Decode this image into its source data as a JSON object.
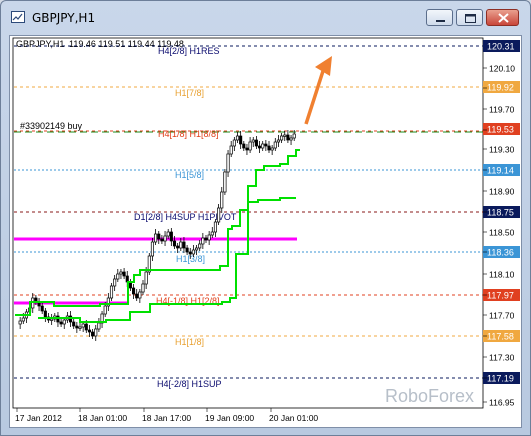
{
  "window": {
    "title": "GBPJPY,H1"
  },
  "chart_header": {
    "symbol_tf": "GBPJPY,H1",
    "ohlc": "119.46 119.51 119.44 119.48"
  },
  "watermark": "RoboForex",
  "order_label": "#33902149 buy",
  "level_labels": [
    {
      "text": "H4[2/8] H1RES",
      "color": "#0a0a6e"
    },
    {
      "text": "H1[7/8]",
      "color": "#e8a030"
    },
    {
      "text": "H4[1/8] H1[8/8]",
      "color": "#e0401a"
    },
    {
      "text": "H1[5/8]",
      "color": "#3b95d6"
    },
    {
      "text": "D1[2/8] H4SUP H1PIVOT",
      "color": "#0a0a6e"
    },
    {
      "text": "H1[3/8]",
      "color": "#3b95d6"
    },
    {
      "text": "H4[-1/8] H1[2/8]",
      "color": "#e0401a"
    },
    {
      "text": "H1[1/8]",
      "color": "#e8a030"
    },
    {
      "text": "H4[-2/8] H1SUP",
      "color": "#0a0a6e"
    }
  ],
  "price_boxes": [
    {
      "value": "120.31",
      "bg": "#0a1a5c",
      "fg": "#ffffff"
    },
    {
      "value": "119.92",
      "bg": "#f0a840",
      "fg": "#ffffff"
    },
    {
      "value": "119.53",
      "bg": "#e04020",
      "fg": "#ffffff"
    },
    {
      "value": "119.14",
      "bg": "#3b95d6",
      "fg": "#ffffff"
    },
    {
      "value": "118.75",
      "bg": "#0a1a5c",
      "fg": "#ffffff"
    },
    {
      "value": "118.36",
      "bg": "#3b95d6",
      "fg": "#ffffff"
    },
    {
      "value": "117.97",
      "bg": "#e04020",
      "fg": "#ffffff"
    },
    {
      "value": "117.58",
      "bg": "#f0a840",
      "fg": "#ffffff"
    },
    {
      "value": "117.19",
      "bg": "#0a1a5c",
      "fg": "#ffffff"
    }
  ],
  "y_ticks": [
    "120.10",
    "119.90",
    "119.70",
    "119.50",
    "119.30",
    "119.10",
    "118.90",
    "118.70",
    "118.50",
    "118.30",
    "118.10",
    "117.90",
    "117.70",
    "117.50",
    "117.30",
    "117.10",
    "116.95"
  ],
  "x_ticks": [
    "17 Jan 2012",
    "18 Jan 01:00",
    "18 Jan 17:00",
    "19 Jan 09:00",
    "20 Jan 01:00"
  ],
  "colors": {
    "pivot_line": "#ff00ff",
    "channel_lines": "#00e000",
    "arrow": "#f08030",
    "candles": "#000000"
  },
  "icons": [
    "chart-window-icon",
    "minimize-icon",
    "maximize-icon",
    "close-icon",
    "up-arrow-annotation"
  ]
}
